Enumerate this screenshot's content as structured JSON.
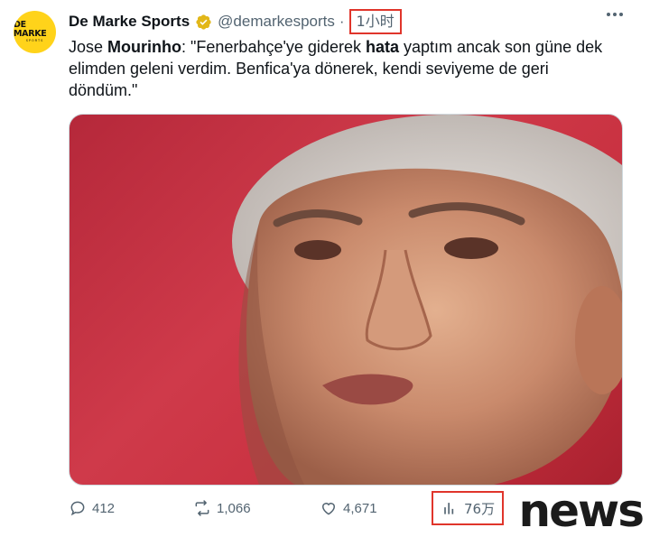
{
  "account": {
    "logo_text": "DE MARKE",
    "logo_subtext": "SPORTS",
    "display_name": "De Marke Sports",
    "verified_icon": "verified-badge-icon",
    "handle": "@demarkesports",
    "separator": "·",
    "time": "1小时"
  },
  "tweet": {
    "t1": "Jose ",
    "b1": "Mourinho",
    "t2": ": \"Fenerbahçe'ye giderek ",
    "b2": "hata",
    "t3": " yaptım ancak son güne dek elimden geleni verdim. Benfica'ya dönerek, kendi seviyeme de geri döndüm.\""
  },
  "actions": {
    "replies": "412",
    "reposts": "1,066",
    "likes": "4,671",
    "views": "76万"
  },
  "icons": {
    "more": "more-icon",
    "reply": "reply-icon",
    "repost": "repost-icon",
    "like": "heart-icon",
    "views": "views-icon"
  },
  "watermark": "news",
  "colors": {
    "highlight_box": "#e0352b",
    "secondary_text": "#536471",
    "verified_gold": "#e2b719",
    "media_background": "#c8303f"
  }
}
